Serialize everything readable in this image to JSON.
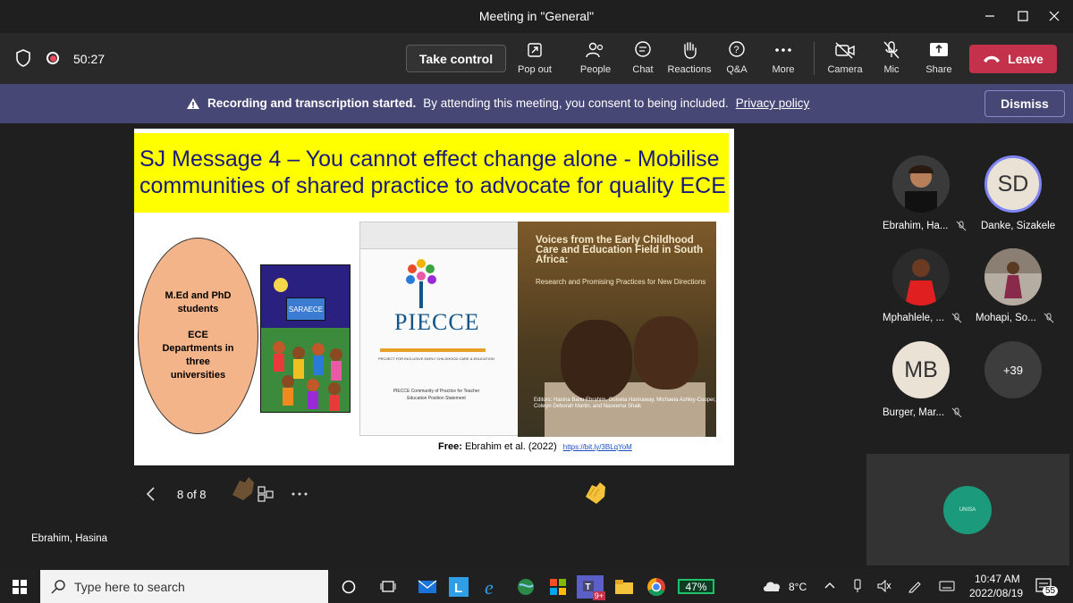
{
  "window": {
    "title": "Meeting in \"General\""
  },
  "toolbar": {
    "timer": "50:27",
    "take_control": "Take control",
    "pop_out": "Pop out",
    "people": "People",
    "chat": "Chat",
    "reactions": "Reactions",
    "qa": "Q&A",
    "more": "More",
    "camera": "Camera",
    "mic": "Mic",
    "share": "Share",
    "leave": "Leave"
  },
  "banner": {
    "bold": "Recording and transcription started.",
    "text": "By attending this meeting, you consent to being included.",
    "link": "Privacy policy",
    "dismiss": "Dismiss"
  },
  "slide": {
    "heading_line1": "SJ Message 4 – You cannot  effect change alone - Mobilise",
    "heading_line2": "communities of shared practice to advocate for quality ECE",
    "ellipse_line1": "M.Ed and PhD",
    "ellipse_line2": "students",
    "ellipse_line3": "ECE",
    "ellipse_line4": "Departments in",
    "ellipse_line5": "three",
    "ellipse_line6": "universities",
    "saraece_label": "SARAECE",
    "piecce_logo": "PIECCE",
    "piecce_subtitle": "PROJECT FOR INCLUSIVE EARLY CHILDHOOD CARE & EDUCATION",
    "piecce_doc_title": "PIECCE Community of Practice for Teacher Education Position Statement",
    "book_title": "Voices from the Early Childhood Care and Education Field in South Africa:",
    "book_subtitle": "Research and Promising Practices for New Directions",
    "book_authors": "Editors: Hasina Banu Ebrahim, Ouiseta Hannaway, Michaela Ashley-Cooper, Colwyn Deborah Martin, and Naseema Shaik",
    "free_label": "Free:",
    "free_citation": "Ebrahim et al. (2022)",
    "free_link": "https://bit.ly/3BLqYoM"
  },
  "slide_controls": {
    "counter": "8 of 8"
  },
  "presenter_name": "Ebrahim, Hasina",
  "participants": [
    {
      "name": "Ebrahim, Ha...",
      "initials": ""
    },
    {
      "name": "Danke, Sizakele",
      "initials": "SD"
    },
    {
      "name": "Mphahlele, ...",
      "initials": ""
    },
    {
      "name": "Mohapi, So...",
      "initials": ""
    },
    {
      "name": "Burger, Mar...",
      "initials": "MB"
    }
  ],
  "more_participants": "+39",
  "self_view_logo": "UNISA",
  "taskbar": {
    "search_placeholder": "Type here to search",
    "battery": "47%",
    "temperature": "8°C",
    "time": "10:47 AM",
    "date": "2022/08/19",
    "notifications": "55",
    "teams_badge": "9+"
  },
  "colors": {
    "accent_banner": "#464775",
    "leave": "#c4314b",
    "slide_heading_bg": "#ffff00",
    "slide_heading_text": "#1a1a7a"
  }
}
